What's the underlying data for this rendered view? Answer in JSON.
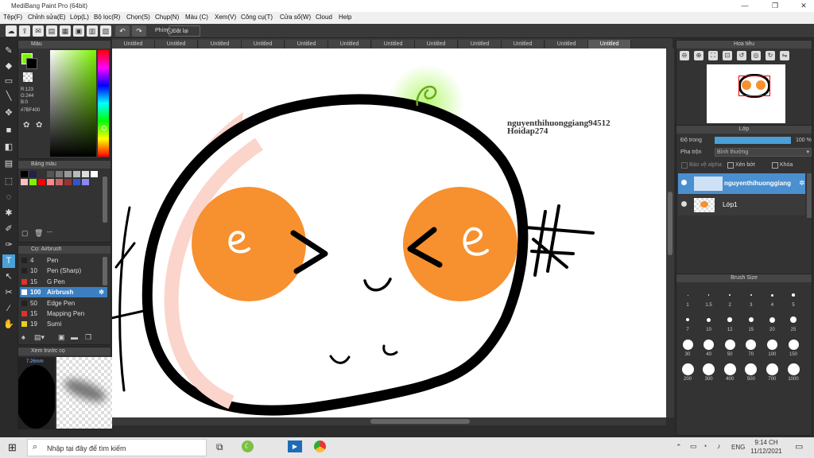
{
  "window": {
    "title": "MediBang Paint Pro (64bit)",
    "min": "—",
    "max": "❐",
    "close": "✕"
  },
  "menu": [
    "Tệp(F)",
    "Chỉnh sửa(E)",
    "Lớp(L)",
    "Bộ lọc(R)",
    "Chọn(S)",
    "Chụp(N)",
    "Màu (C)",
    "Xem(V)",
    "Công cụ(T)",
    "Cửa sổ(W)",
    "Cloud",
    "Help"
  ],
  "toolbar": {
    "shortcut_label": "Phím",
    "reset_label": "Đặt lại"
  },
  "color_panel": {
    "title": "Màu",
    "r": "R:123",
    "g": "G:244",
    "b": "B:0",
    "hex": "#7BF400",
    "fg": "#7BF400",
    "bg": "#000000"
  },
  "palette": {
    "title": "Bảng màu",
    "footer": "---",
    "swatches": [
      "#000000",
      "#222244",
      "#333333",
      "#555555",
      "#777777",
      "#999999",
      "#bbbbbb",
      "#dddddd",
      "#ffffff",
      "#ffc0c0",
      "#7bf400",
      "#ff0000",
      "#ff8888",
      "#cc6666",
      "#993333",
      "#3355cc",
      "#8888ee"
    ]
  },
  "brush_panel": {
    "title": "Cọ: Airbrush",
    "items": [
      {
        "size": "4",
        "name": "Pen",
        "color": "#222222"
      },
      {
        "size": "10",
        "name": "Pen (Sharp)",
        "color": "#222222"
      },
      {
        "size": "15",
        "name": "G Pen",
        "color": "#e03030"
      },
      {
        "size": "100",
        "name": "Airbrush",
        "color": "#ffffff"
      },
      {
        "size": "50",
        "name": "Edge Pen",
        "color": "#222222"
      },
      {
        "size": "15",
        "name": "Mapping Pen",
        "color": "#e03030"
      },
      {
        "size": "19",
        "name": "Sumi",
        "color": "#e8d020"
      }
    ]
  },
  "preview_panel": {
    "title": "Xem trước cọ",
    "size": "7.26mm"
  },
  "tabs": [
    "Untitled",
    "Untitled",
    "Untitled",
    "Untitled",
    "Untitled",
    "Untitled",
    "Untitled",
    "Untitled",
    "Untitled",
    "Untitled",
    "Untitled",
    "Untitled"
  ],
  "canvas": {
    "watermark_line1": "nguyenthihuonggiang94512",
    "watermark_line2": "Hoidap274"
  },
  "navigator": {
    "title": "Hoa tiêu"
  },
  "layers": {
    "title": "Lớp",
    "opacity_label": "Độ trong",
    "opacity_value": "100 %",
    "blend_label": "Pha trộn",
    "blend_value": "Bình thường",
    "alpha_label": "Bảo vệ alpha",
    "clip_label": "Xén bớt",
    "lock_label": "Khóa",
    "items": [
      {
        "name": "nguyenthihuonggiang"
      },
      {
        "name": "Lớp1"
      }
    ]
  },
  "brush_size": {
    "title": "Brush Size",
    "sizes": [
      "1",
      "1.5",
      "2",
      "3",
      "4",
      "5",
      "7",
      "10",
      "12",
      "15",
      "20",
      "25",
      "30",
      "40",
      "50",
      "70",
      "100",
      "150",
      "200",
      "300",
      "400",
      "500",
      "700",
      "1000"
    ]
  },
  "taskbar": {
    "search_placeholder": "Nhập tại đây để tìm kiếm",
    "lang": "ENG",
    "time": "9:14 CH",
    "date": "11/12/2021"
  }
}
